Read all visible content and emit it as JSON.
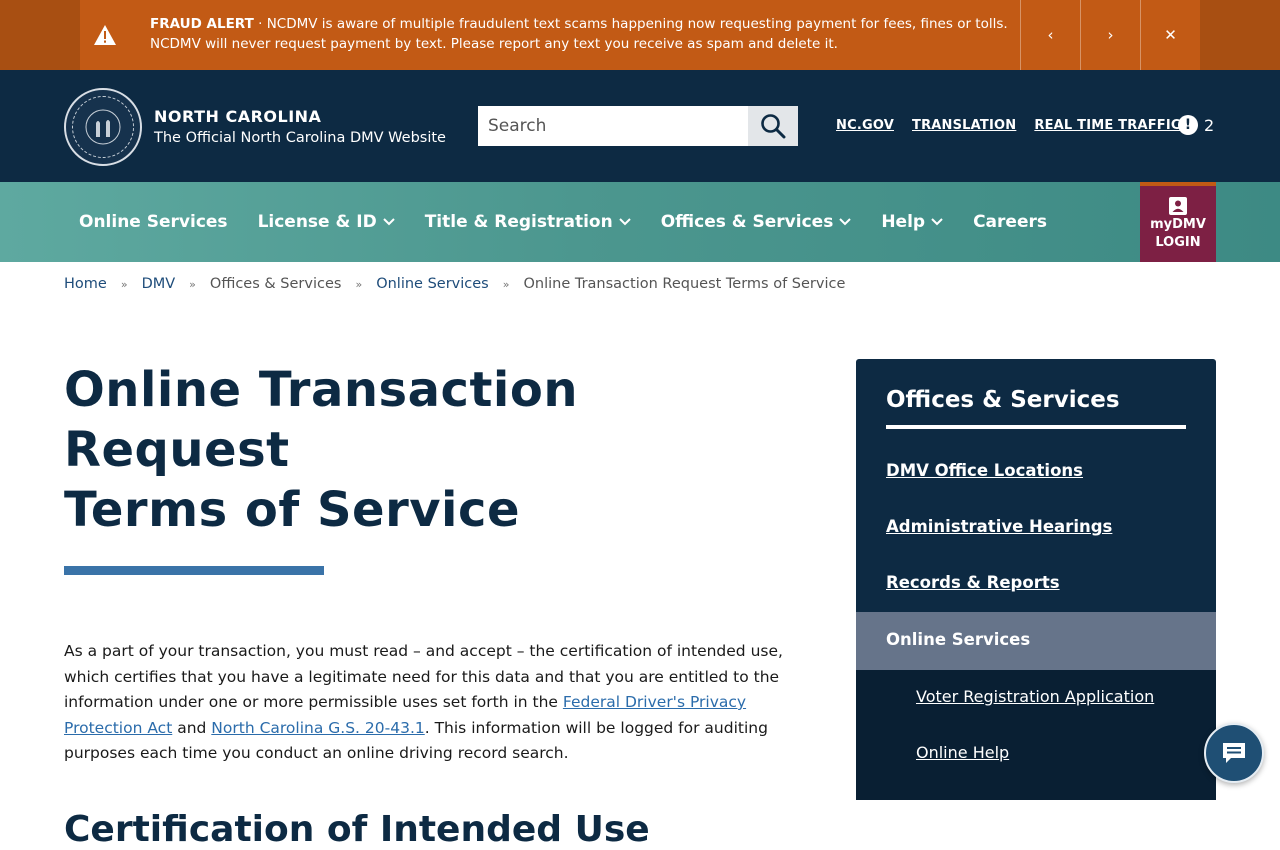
{
  "alert": {
    "label": "FRAUD ALERT",
    "separator": "·",
    "text": "NCDMV is aware of multiple fraudulent text scams happening now requesting payment for fees, fines or tolls. NCDMV will never request payment by text. Please report any text you receive as spam and delete it.",
    "prev_icon": "‹",
    "next_icon": "›",
    "close_icon": "✕"
  },
  "header": {
    "title": "NORTH CAROLINA",
    "subtitle": "The Official North Carolina DMV Website",
    "search_placeholder": "Search",
    "links": [
      "NC.GOV",
      "TRANSLATION",
      "REAL TIME TRAFFIC"
    ],
    "alerts_icon": "!",
    "alerts_count": "2"
  },
  "nav": {
    "items": [
      {
        "label": "Online Services",
        "chevron": ""
      },
      {
        "label": "License & ID",
        "chevron": "⌄"
      },
      {
        "label": "Title & Registration",
        "chevron": "⌄"
      },
      {
        "label": "Offices & Services",
        "chevron": "⌄"
      },
      {
        "label": "Help",
        "chevron": "⌄"
      },
      {
        "label": "Careers",
        "chevron": ""
      }
    ],
    "mydmv_line1": "myDMV",
    "mydmv_line2": "LOGIN"
  },
  "breadcrumb": {
    "sep": "»",
    "items": [
      "Home",
      "DMV",
      "Offices & Services",
      "Online Services",
      "Online Transaction Request Terms of Service"
    ]
  },
  "main": {
    "title_line1": "Online Transaction Request",
    "title_line2": "Terms of Service",
    "intro_part1": "As a part of your transaction, you must read – and accept – the certification of intended use, which certifies that you have a legitimate need for this data and that you are entitled to the information under one or more permissible uses set forth in the ",
    "intro_link1": "Federal Driver's Privacy Protection Act",
    "intro_part2": " and ",
    "intro_link2": "North Carolina G.S. 20-43.1",
    "intro_part3": ". This information will be logged for auditing purposes each time you conduct an online driving record search.",
    "heading2": "Certification of Intended Use"
  },
  "sidebar": {
    "title": "Offices & Services",
    "links": [
      "DMV Office Locations",
      "Administrative Hearings",
      "Records & Reports"
    ],
    "active": "Online Services",
    "sublinks": [
      "Voter Registration Application",
      "Online Help"
    ]
  },
  "colors": {
    "alert_bg": "#c25a15",
    "header_bg": "#0d2a43",
    "nav_bg": "#4c978f",
    "mydmv_bg": "#7d2044",
    "accent_bar": "#3a73a8"
  }
}
